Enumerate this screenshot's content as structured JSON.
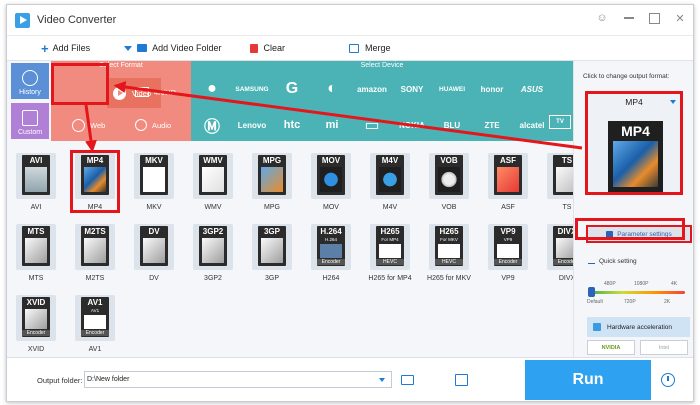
{
  "window": {
    "title": "Video Converter"
  },
  "toolbar": {
    "add_files": "Add Files",
    "add_video_folder": "Add Video Folder",
    "clear": "Clear",
    "merge": "Merge"
  },
  "sidebar": {
    "history": "History",
    "custom": "Custom"
  },
  "format_panel": {
    "select_format_label": "Select Format",
    "select_device_label": "Select Device",
    "categories": [
      {
        "label": "Video"
      },
      {
        "label": "4K/HD"
      },
      {
        "label": "Web"
      },
      {
        "label": "Audio"
      }
    ]
  },
  "devices": [
    "SAMSUNG",
    "amazon",
    "SONY",
    "HUAWEI",
    "honor",
    "ASUS",
    "Lenovo",
    "htc",
    "mi",
    "NOKIA",
    "BLU",
    "ZTE",
    "alcatel",
    "TV"
  ],
  "formats": [
    {
      "name": "AVI",
      "label": "AVI",
      "sub": "",
      "enc": ""
    },
    {
      "name": "MP4",
      "label": "MP4",
      "sub": "",
      "enc": ""
    },
    {
      "name": "MKV",
      "label": "MKV",
      "sub": "",
      "enc": ""
    },
    {
      "name": "WMV",
      "label": "WMV",
      "sub": "",
      "enc": ""
    },
    {
      "name": "MPG",
      "label": "MPG",
      "sub": "",
      "enc": ""
    },
    {
      "name": "MOV",
      "label": "MOV",
      "sub": "",
      "enc": ""
    },
    {
      "name": "M4V",
      "label": "M4V",
      "sub": "",
      "enc": ""
    },
    {
      "name": "VOB",
      "label": "VOB",
      "sub": "",
      "enc": ""
    },
    {
      "name": "ASF",
      "label": "ASF",
      "sub": "",
      "enc": ""
    },
    {
      "name": "TS",
      "label": "TS",
      "sub": "",
      "enc": ""
    },
    {
      "name": "MTS",
      "label": "MTS",
      "sub": "",
      "enc": ""
    },
    {
      "name": "M2TS",
      "label": "M2TS",
      "sub": "",
      "enc": ""
    },
    {
      "name": "DV",
      "label": "DV",
      "sub": "",
      "enc": ""
    },
    {
      "name": "3GP2",
      "label": "3GP2",
      "sub": "",
      "enc": ""
    },
    {
      "name": "3GP",
      "label": "3GP",
      "sub": "",
      "enc": ""
    },
    {
      "name": "H264",
      "label": "H.264",
      "sub": "H.264",
      "enc": "Encoder"
    },
    {
      "name": "H265 for MP4",
      "label": "H265",
      "sub": "For MP4",
      "enc": "HEVC"
    },
    {
      "name": "H265 for MKV",
      "label": "H265",
      "sub": "For MKV",
      "enc": "HEVC"
    },
    {
      "name": "VP9",
      "label": "VP9",
      "sub": "VP9",
      "enc": "Encoder"
    },
    {
      "name": "DIVX",
      "label": "DIVX",
      "sub": "",
      "enc": "Encoder"
    },
    {
      "name": "XVID",
      "label": "XVID",
      "sub": "",
      "enc": "Encoder"
    },
    {
      "name": "AV1",
      "label": "AV1",
      "sub": "AV1",
      "enc": "Encoder"
    }
  ],
  "output": {
    "hint": "Click to change output format:",
    "format": "MP4",
    "parameter_settings": "Parameter settings",
    "quick_setting": "Quick setting",
    "ticks_top": [
      "480P",
      "1080P",
      "4K"
    ],
    "ticks_bottom": [
      "Default",
      "720P",
      "2K"
    ],
    "quick_level_percent": 0,
    "hardware_acceleration": "Hardware acceleration",
    "gpu": [
      "NVIDIA",
      "Intel"
    ]
  },
  "bottom": {
    "output_folder_label": "Output folder:",
    "output_folder_value": "D:\\New folder",
    "run": "Run"
  },
  "colors": {
    "accent": "#2ea2f0",
    "highlight": "#e4161b",
    "format_bg": "#f18b7f",
    "device_bg": "#4bb3b5"
  }
}
